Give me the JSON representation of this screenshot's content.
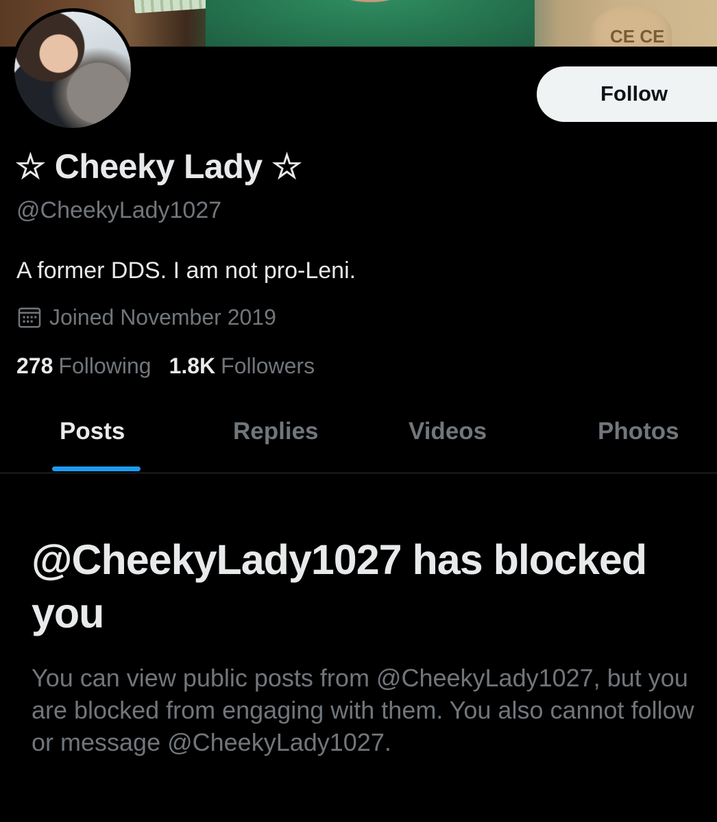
{
  "profile": {
    "display_name": "☆ Cheeky Lady ☆",
    "handle": "@CheekyLady1027",
    "bio": "A former DDS. I am not pro-Leni.",
    "joined": "Joined November 2019",
    "following_count": "278",
    "following_label": "Following",
    "followers_count": "1.8K",
    "followers_label": "Followers",
    "follow_button": "Follow"
  },
  "banner": {
    "bag_text": "CE CE"
  },
  "icons": {
    "joined": "calendar-icon"
  },
  "tabs": [
    {
      "label": "Posts",
      "active": true
    },
    {
      "label": "Replies",
      "active": false
    },
    {
      "label": "Videos",
      "active": false
    },
    {
      "label": "Photos",
      "active": false
    }
  ],
  "blocked": {
    "title": "@CheekyLady1027 has blocked you",
    "body": "You can view public posts from @CheekyLady1027, but you are blocked from engaging with them. You also cannot follow or message @CheekyLady1027."
  },
  "colors": {
    "background": "#000000",
    "text_primary": "#e7e9ea",
    "text_secondary": "#71767b",
    "accent": "#1d9bf0",
    "button_bg": "#eff3f4"
  }
}
